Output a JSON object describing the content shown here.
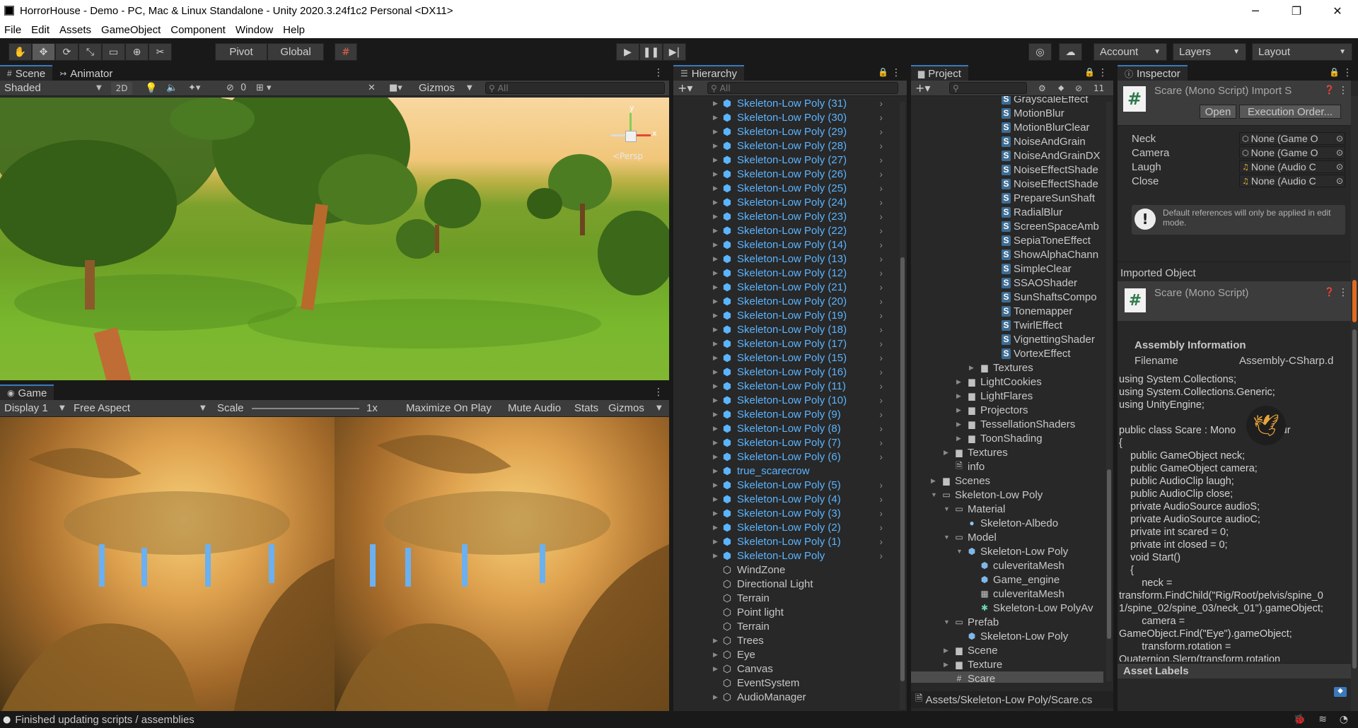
{
  "window": {
    "title": "HorrorHouse - Demo - PC, Mac & Linux Standalone - Unity 2020.3.24f1c2 Personal <DX11>",
    "controls": [
      "─",
      "❐",
      "✕"
    ]
  },
  "menubar": [
    "File",
    "Edit",
    "Assets",
    "GameObject",
    "Component",
    "Window",
    "Help"
  ],
  "toolbar": {
    "pivot_label": "Pivot",
    "global_label": "Global",
    "account_label": "Account",
    "layers_label": "Layers",
    "layout_label": "Layout"
  },
  "scene_panel": {
    "tabs": [
      "Scene",
      "Animator"
    ],
    "shading_mode": "Shaded",
    "mode_2d": "2D",
    "hidden_count": "0",
    "gizmos_label": "Gizmos",
    "search_placeholder": "All",
    "gizmo_y": "y",
    "gizmo_x": "x",
    "persp_label": "<Persp"
  },
  "game_panel": {
    "tab": "Game",
    "display": "Display 1",
    "aspect": "Free Aspect",
    "scale_label": "Scale",
    "scale_value": "1x",
    "options": [
      "Maximize On Play",
      "Mute Audio",
      "Stats",
      "Gizmos"
    ]
  },
  "hierarchy": {
    "tab": "Hierarchy",
    "search_placeholder": "All",
    "items": [
      {
        "label": "Skeleton-Low Poly (31)",
        "prefab": true
      },
      {
        "label": "Skeleton-Low Poly (30)",
        "prefab": true
      },
      {
        "label": "Skeleton-Low Poly (29)",
        "prefab": true
      },
      {
        "label": "Skeleton-Low Poly (28)",
        "prefab": true
      },
      {
        "label": "Skeleton-Low Poly (27)",
        "prefab": true
      },
      {
        "label": "Skeleton-Low Poly (26)",
        "prefab": true
      },
      {
        "label": "Skeleton-Low Poly (25)",
        "prefab": true
      },
      {
        "label": "Skeleton-Low Poly (24)",
        "prefab": true
      },
      {
        "label": "Skeleton-Low Poly (23)",
        "prefab": true
      },
      {
        "label": "Skeleton-Low Poly (22)",
        "prefab": true
      },
      {
        "label": "Skeleton-Low Poly (14)",
        "prefab": true
      },
      {
        "label": "Skeleton-Low Poly (13)",
        "prefab": true
      },
      {
        "label": "Skeleton-Low Poly (12)",
        "prefab": true
      },
      {
        "label": "Skeleton-Low Poly (21)",
        "prefab": true
      },
      {
        "label": "Skeleton-Low Poly (20)",
        "prefab": true
      },
      {
        "label": "Skeleton-Low Poly (19)",
        "prefab": true
      },
      {
        "label": "Skeleton-Low Poly (18)",
        "prefab": true
      },
      {
        "label": "Skeleton-Low Poly (17)",
        "prefab": true
      },
      {
        "label": "Skeleton-Low Poly (15)",
        "prefab": true
      },
      {
        "label": "Skeleton-Low Poly (16)",
        "prefab": true
      },
      {
        "label": "Skeleton-Low Poly (11)",
        "prefab": true
      },
      {
        "label": "Skeleton-Low Poly (10)",
        "prefab": true
      },
      {
        "label": "Skeleton-Low Poly (9)",
        "prefab": true
      },
      {
        "label": "Skeleton-Low Poly (8)",
        "prefab": true
      },
      {
        "label": "Skeleton-Low Poly (7)",
        "prefab": true
      },
      {
        "label": "Skeleton-Low Poly (6)",
        "prefab": true
      },
      {
        "label": "true_scarecrow",
        "prefab": true
      },
      {
        "label": "Skeleton-Low Poly (5)",
        "prefab": true
      },
      {
        "label": "Skeleton-Low Poly (4)",
        "prefab": true
      },
      {
        "label": "Skeleton-Low Poly (3)",
        "prefab": true
      },
      {
        "label": "Skeleton-Low Poly (2)",
        "prefab": true
      },
      {
        "label": "Skeleton-Low Poly (1)",
        "prefab": true
      },
      {
        "label": "Skeleton-Low Poly",
        "prefab": true
      },
      {
        "label": "WindZone",
        "prefab": false
      },
      {
        "label": "Directional Light",
        "prefab": false
      },
      {
        "label": "Terrain",
        "prefab": false
      },
      {
        "label": "Point light",
        "prefab": false
      },
      {
        "label": "Terrain",
        "prefab": false
      },
      {
        "label": "Trees",
        "prefab": false
      },
      {
        "label": "Eye",
        "prefab": false
      },
      {
        "label": "Canvas",
        "prefab": false
      },
      {
        "label": "EventSystem",
        "prefab": false
      },
      {
        "label": "AudioManager",
        "prefab": false
      }
    ]
  },
  "project": {
    "tab": "Project",
    "hidden_count": "11",
    "path": "Assets/Skeleton-Low Poly/Scare.cs",
    "items": [
      {
        "label": "GrayscaleEffect",
        "type": "script",
        "depth": 4
      },
      {
        "label": "MotionBlur",
        "type": "script",
        "depth": 4
      },
      {
        "label": "MotionBlurClear",
        "type": "script",
        "depth": 4
      },
      {
        "label": "NoiseAndGrain",
        "type": "script",
        "depth": 4
      },
      {
        "label": "NoiseAndGrainDX",
        "type": "script",
        "depth": 4
      },
      {
        "label": "NoiseEffectShade",
        "type": "script",
        "depth": 4
      },
      {
        "label": "NoiseEffectShade",
        "type": "script",
        "depth": 4
      },
      {
        "label": "PrepareSunShaft",
        "type": "script",
        "depth": 4
      },
      {
        "label": "RadialBlur",
        "type": "script",
        "depth": 4
      },
      {
        "label": "ScreenSpaceAmb",
        "type": "script",
        "depth": 4
      },
      {
        "label": "SepiaToneEffect",
        "type": "script",
        "depth": 4
      },
      {
        "label": "ShowAlphaChann",
        "type": "script",
        "depth": 4
      },
      {
        "label": "SimpleClear",
        "type": "script",
        "depth": 4
      },
      {
        "label": "SSAOShader",
        "type": "script",
        "depth": 4
      },
      {
        "label": "SunShaftsCompo",
        "type": "script",
        "depth": 4
      },
      {
        "label": "Tonemapper",
        "type": "script",
        "depth": 4
      },
      {
        "label": "TwirlEffect",
        "type": "script",
        "depth": 4
      },
      {
        "label": "VignettingShader",
        "type": "script",
        "depth": 4
      },
      {
        "label": "VortexEffect",
        "type": "script",
        "depth": 4
      },
      {
        "label": "Textures",
        "type": "folder",
        "depth": 3
      },
      {
        "label": "LightCookies",
        "type": "folder",
        "depth": 2
      },
      {
        "label": "LightFlares",
        "type": "folder",
        "depth": 2
      },
      {
        "label": "Projectors",
        "type": "folder",
        "depth": 2
      },
      {
        "label": "TessellationShaders",
        "type": "folder",
        "depth": 2
      },
      {
        "label": "ToonShading",
        "type": "folder",
        "depth": 2
      },
      {
        "label": "Textures",
        "type": "folder",
        "depth": 1
      },
      {
        "label": "info",
        "type": "doc",
        "depth": 1
      },
      {
        "label": "Scenes",
        "type": "folder",
        "depth": 0
      },
      {
        "label": "Skeleton-Low Poly",
        "type": "folder-open",
        "depth": 0
      },
      {
        "label": "Material",
        "type": "folder-open",
        "depth": 1
      },
      {
        "label": "Skeleton-Albedo",
        "type": "material",
        "depth": 2
      },
      {
        "label": "Model",
        "type": "folder-open",
        "depth": 1
      },
      {
        "label": "Skeleton-Low Poly",
        "type": "model",
        "depth": 2
      },
      {
        "label": "culeveritaMesh",
        "type": "mesh",
        "depth": 3
      },
      {
        "label": "Game_engine",
        "type": "mesh",
        "depth": 3
      },
      {
        "label": "culeveritaMesh",
        "type": "grid",
        "depth": 3
      },
      {
        "label": "Skeleton-Low PolyAv",
        "type": "avatar",
        "depth": 3
      },
      {
        "label": "Prefab",
        "type": "folder-open",
        "depth": 1
      },
      {
        "label": "Skeleton-Low Poly",
        "type": "prefab",
        "depth": 2
      },
      {
        "label": "Scene",
        "type": "folder",
        "depth": 1
      },
      {
        "label": "Texture",
        "type": "folder",
        "depth": 1
      },
      {
        "label": "Scare",
        "type": "cs",
        "depth": 1,
        "selected": true
      }
    ]
  },
  "inspector": {
    "tab": "Inspector",
    "header_title": "Scare (Mono Script) Import S",
    "open_label": "Open",
    "exec_order_label": "Execution Order...",
    "fields": [
      {
        "label": "Neck",
        "value": "None (Game O",
        "icon": "⬡"
      },
      {
        "label": "Camera",
        "value": "None (Game O",
        "icon": "⬡"
      },
      {
        "label": "Laugh",
        "value": "None (Audio C",
        "icon": "♫"
      },
      {
        "label": "Close",
        "value": "None (Audio C",
        "icon": "♫"
      }
    ],
    "info_text": "Default references will only be applied in edit mode.",
    "imported_object_label": "Imported Object",
    "imported_title": "Scare (Mono Script)",
    "assembly_header": "Assembly Information",
    "filename_label": "Filename",
    "filename_value": "Assembly-CSharp.d",
    "code": "using System.Collections;\nusing System.Collections.Generic;\nusing UnityEngine;\n\npublic class Scare : Mono                ur\n{\n    public GameObject neck;\n    public GameObject camera;\n    public AudioClip laugh;\n    public AudioClip close;\n    private AudioSource audioS;\n    private AudioSource audioC;\n    private int scared = 0;\n    private int closed = 0;\n    void Start()\n    {\n        neck =\ntransform.FindChild(\"Rig/Root/pelvis/spine_0\n1/spine_02/spine_03/neck_01\").gameObject;\n        camera =\nGameObject.Find(\"Eye\").gameObject;\n        transform.rotation =\nQuaternion.Slerp(transform.rotation",
    "asset_labels": "Asset Labels"
  },
  "status": {
    "message": "Finished updating scripts / assemblies"
  }
}
